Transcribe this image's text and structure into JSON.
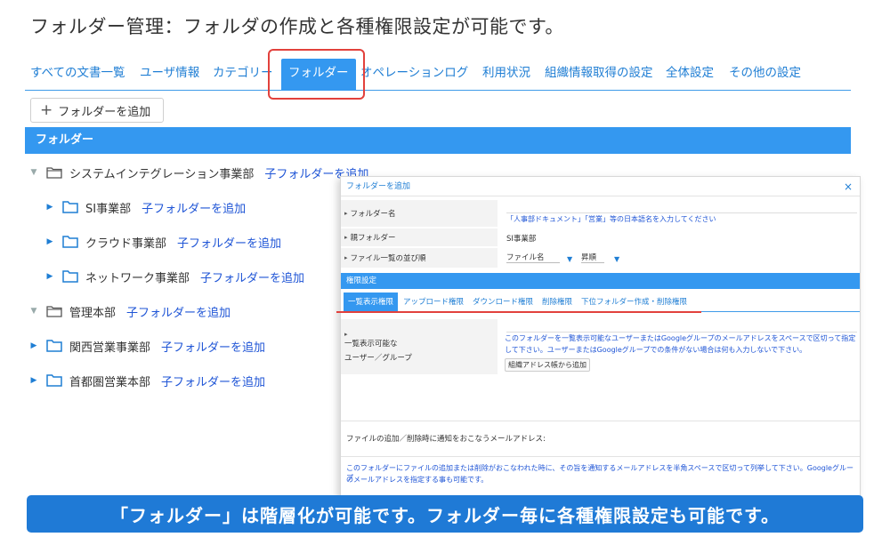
{
  "page_title": "フォルダー管理：フォルダの作成と各種権限設定が可能です。",
  "tabs": [
    {
      "label": "すべての文書一覧"
    },
    {
      "label": "ユーザ情報"
    },
    {
      "label": "カテゴリー"
    },
    {
      "label": "フォルダー",
      "active": true
    },
    {
      "label": "オペレーションログ"
    },
    {
      "label": "利用状況"
    },
    {
      "label": "組織情報取得の設定"
    },
    {
      "label": "全体設定"
    },
    {
      "label": "その他の設定"
    }
  ],
  "add_folder_button": "フォルダーを追加",
  "folder_section_title": "フォルダー",
  "tree": [
    {
      "name": "システムインテグレーション事業部",
      "add": "子フォルダーを追加",
      "expanded": true,
      "level": 0
    },
    {
      "name": "SI事業部",
      "add": "子フォルダーを追加",
      "expanded": false,
      "level": 1
    },
    {
      "name": "クラウド事業部",
      "add": "子フォルダーを追加",
      "expanded": false,
      "level": 1
    },
    {
      "name": "ネットワーク事業部",
      "add": "子フォルダーを追加",
      "expanded": false,
      "level": 1
    },
    {
      "name": "管理本部",
      "add": "子フォルダーを追加",
      "expanded": true,
      "level": 0
    },
    {
      "name": "関西営業事業部",
      "add": "子フォルダーを追加",
      "expanded": false,
      "level": 0
    },
    {
      "name": "首都圏営業本部",
      "add": "子フォルダーを追加",
      "expanded": false,
      "level": 0
    }
  ],
  "dialog": {
    "title": "フォルダーを追加",
    "close": "×",
    "folder_name_label": "フォルダー名",
    "folder_name_hint": "「人事部ドキュメント」「営業」等の日本語名を入力してください",
    "parent_label": "親フォルダー",
    "parent_value": "SI事業部",
    "sort_label": "ファイル一覧の並び順",
    "sort_field": "ファイル名",
    "sort_order": "昇順",
    "perm_title": "権限設定",
    "perm_tabs": [
      {
        "label": "一覧表示権限",
        "active": true
      },
      {
        "label": "アップロード権限"
      },
      {
        "label": "ダウンロード権限"
      },
      {
        "label": "削除権限"
      },
      {
        "label": "下位フォルダー作成・削除権限"
      }
    ],
    "viewable_label_line1": "一覧表示可能な",
    "viewable_label_line2": "ユーザー／グループ",
    "viewable_hint_1": "このフォルダーを一覧表示可能なユーザーまたはGoogleグループのメールアドレスをスペースで区切って指定",
    "viewable_hint_2": "して下さい。ユーザーまたはGoogleグループでの条件がない場合は何も入力しないで下さい。",
    "address_book_button": "組織アドレス帳から追加",
    "notify_label": "ファイルの追加／削除時に通知をおこなうメールアドレス:",
    "notify_hint_1": "このフォルダーにファイルの追加または削除がおこなわれた時に、その旨を通知するメールアドレスを半角スペースで区切って列挙して下さい。Googleグループ",
    "notify_hint_2": "のメールアドレスを指定する事も可能です。"
  },
  "caption": "「フォルダー」は階層化が可能です。フォルダー毎に各種権限設定も可能です。",
  "colors": {
    "accent": "#3498f0",
    "link": "#1f55d6",
    "highlight": "#e2413c",
    "banner": "#1f7ad6"
  }
}
